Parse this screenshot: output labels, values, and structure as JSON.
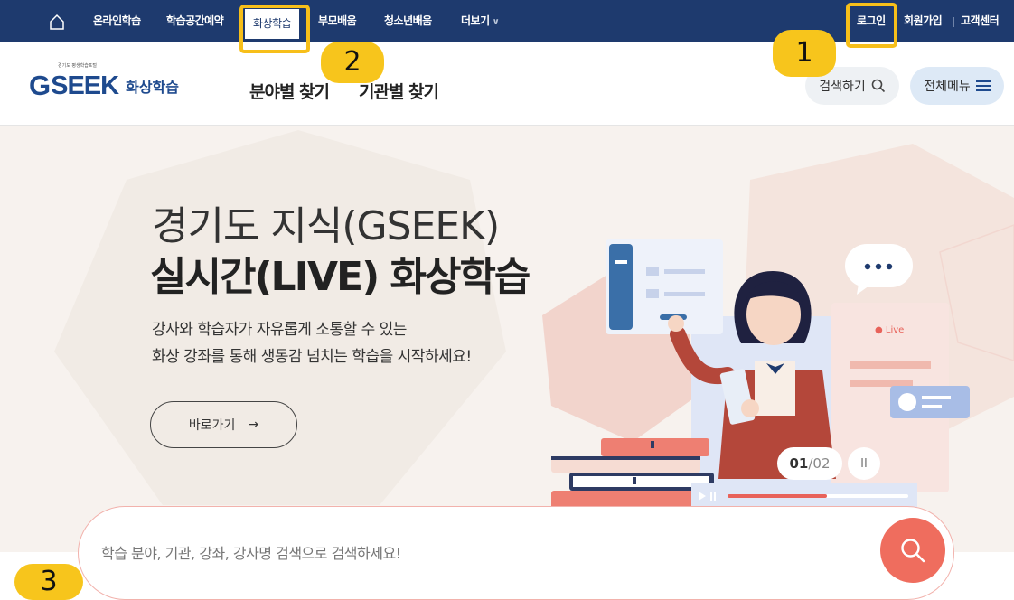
{
  "topnav": {
    "items": [
      "온라인학습",
      "학습공간예약",
      "화상학습",
      "부모배움",
      "청소년배움",
      "더보기"
    ],
    "active": "화상학습",
    "util": [
      "로그인",
      "회원가입",
      "고객센터"
    ]
  },
  "header": {
    "logo_small": "경기도 평생학습포털",
    "logo_g": "G",
    "logo_name": "SEEK",
    "logo_sub": "화상학습",
    "nav": [
      "분야별 찾기",
      "기관별 찾기"
    ],
    "search_label": "검색하기",
    "menu_label": "전체메뉴"
  },
  "hero": {
    "title_line1": "경기도 지식(GSEEK)",
    "title_line2": "실시간(LIVE) 화상학습",
    "desc_line1": "강사와 학습자가 자유롭게 소통할 수 있는",
    "desc_line2": "화상 강좌를 통해 생동감 넘치는 학습을 시작하세요!",
    "go_button": "바로가기",
    "go_arrow": "→",
    "live_label": "● Live",
    "slide_current": "01",
    "slide_total": "/02",
    "pause_icon": "II"
  },
  "search": {
    "placeholder": "학습 분야, 기관, 강좌, 강사명 검색으로 검색하세요!"
  },
  "annotations": {
    "badges": [
      "1",
      "2",
      "3"
    ],
    "color": "#f7bf1a"
  },
  "colors": {
    "topbar": "#1e3a6e",
    "brand": "#1e4a8e",
    "accent": "#ef6d5e",
    "hero_bg": "#f7f2ee"
  }
}
